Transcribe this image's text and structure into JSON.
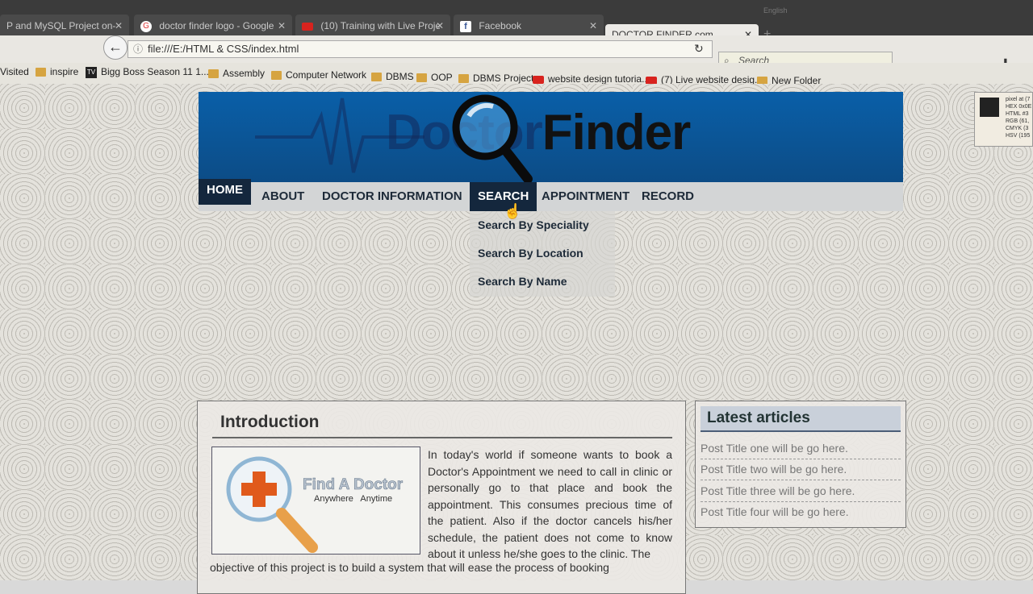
{
  "browser": {
    "tabs": [
      {
        "label": "P and MySQL Project on-",
        "icon": "none"
      },
      {
        "label": "doctor finder logo - Google",
        "icon": "google-icon"
      },
      {
        "label": "(10) Training with Live Proje",
        "icon": "youtube-icon"
      },
      {
        "label": "Facebook",
        "icon": "facebook-icon"
      },
      {
        "label": "DOCTOR FINDER.com",
        "icon": "none",
        "active": true
      }
    ],
    "url": "file:///E:/HTML & CSS/index.html",
    "search_placeholder": "Search",
    "lang_indicator": "English",
    "bookmarks": [
      {
        "label": "Visited",
        "icon": "none"
      },
      {
        "label": "inspire",
        "icon": "folder-icon"
      },
      {
        "label": "Bigg Boss Season 11 1...",
        "icon": "tv-icon"
      },
      {
        "label": "Assembly",
        "icon": "folder-icon"
      },
      {
        "label": "Computer Network",
        "icon": "folder-icon"
      },
      {
        "label": "DBMS",
        "icon": "folder-icon"
      },
      {
        "label": "OOP",
        "icon": "folder-icon"
      },
      {
        "label": "DBMS Project",
        "icon": "folder-icon"
      },
      {
        "label": "website design tutoria...",
        "icon": "youtube-icon"
      },
      {
        "label": "(7) Live website desig...",
        "icon": "youtube-icon"
      },
      {
        "label": "New Folder",
        "icon": "folder-icon"
      }
    ]
  },
  "site": {
    "logo": {
      "part1": "Doctor",
      "part2": "Finder"
    },
    "menu": [
      "HOME",
      "ABOUT",
      "DOCTOR INFORMATION",
      "SEARCH",
      "APPOINTMENT",
      "RECORD"
    ],
    "dropdown": [
      "Search By Speciality",
      "Search By Location",
      "Search By Name"
    ],
    "intro": {
      "heading": "Introduction",
      "image_title": "Find A Doctor",
      "image_subtitle": "Anywhere Anytime",
      "text": "In today's world if someone wants to book a Doctor's Appointment we need to call in clinic or personally go to that place and book the appointment. This consumes precious time of the patient. Also if the doctor cancels his/her schedule, the patient does not come to know about it unless he/she goes to the clinic. The",
      "text_continued": "objective of this project is to build a system that will ease the process of booking"
    },
    "articles": {
      "heading": "Latest articles",
      "items": [
        "Post Title one will be go here.",
        "Post Title two will be go here.",
        "Post Title three will be go here.",
        "Post Title four will be go here."
      ]
    }
  },
  "picker": {
    "lines": [
      "pixel at (7",
      "HEX 0x0E",
      "HTML #3",
      "RGB (61,",
      "CMYK (3",
      "HSV (195"
    ]
  },
  "colors": {
    "banner": "#0c5a9e",
    "menu_active": "#14273d",
    "menu_bg": "#d3d5d6"
  }
}
